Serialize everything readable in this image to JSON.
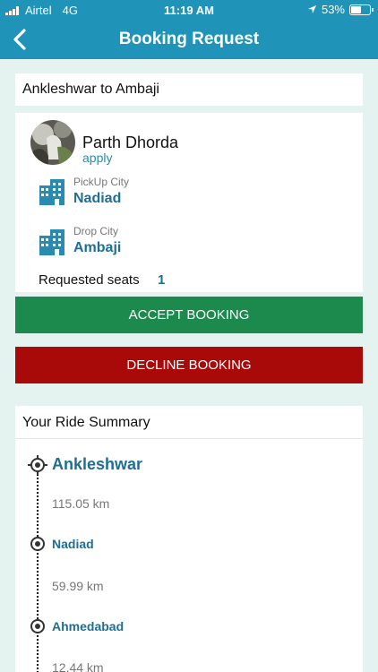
{
  "status_bar": {
    "carrier": "Airtel",
    "network": "4G",
    "time": "11:19 AM",
    "battery": "53%",
    "battery_level": 0.53
  },
  "header": {
    "title": "Booking Request"
  },
  "route": {
    "title": "Ankleshwar to Ambaji"
  },
  "requester": {
    "name": "Parth Dhorda",
    "subtitle": "apply"
  },
  "pickup": {
    "label": "PickUp City",
    "city": "Nadiad"
  },
  "drop": {
    "label": "Drop City",
    "city": "Ambaji"
  },
  "seats": {
    "label": "Requested seats",
    "count": "1"
  },
  "actions": {
    "accept_label": "ACCEPT BOOKING",
    "decline_label": "DECLINE BOOKING",
    "accept_color": "#1b8a4c",
    "decline_color": "#a80a0a"
  },
  "summary": {
    "title": "Your Ride Summary",
    "stops": [
      {
        "name": "Ankleshwar",
        "distance_to_next": "115.05 km"
      },
      {
        "name": "Nadiad",
        "distance_to_next": "59.99 km"
      },
      {
        "name": "Ahmedabad",
        "distance_to_next": "12.44 km"
      }
    ]
  },
  "colors": {
    "primary": "#1f93b8",
    "background": "#e4f2f0",
    "link": "#1e6f93"
  }
}
